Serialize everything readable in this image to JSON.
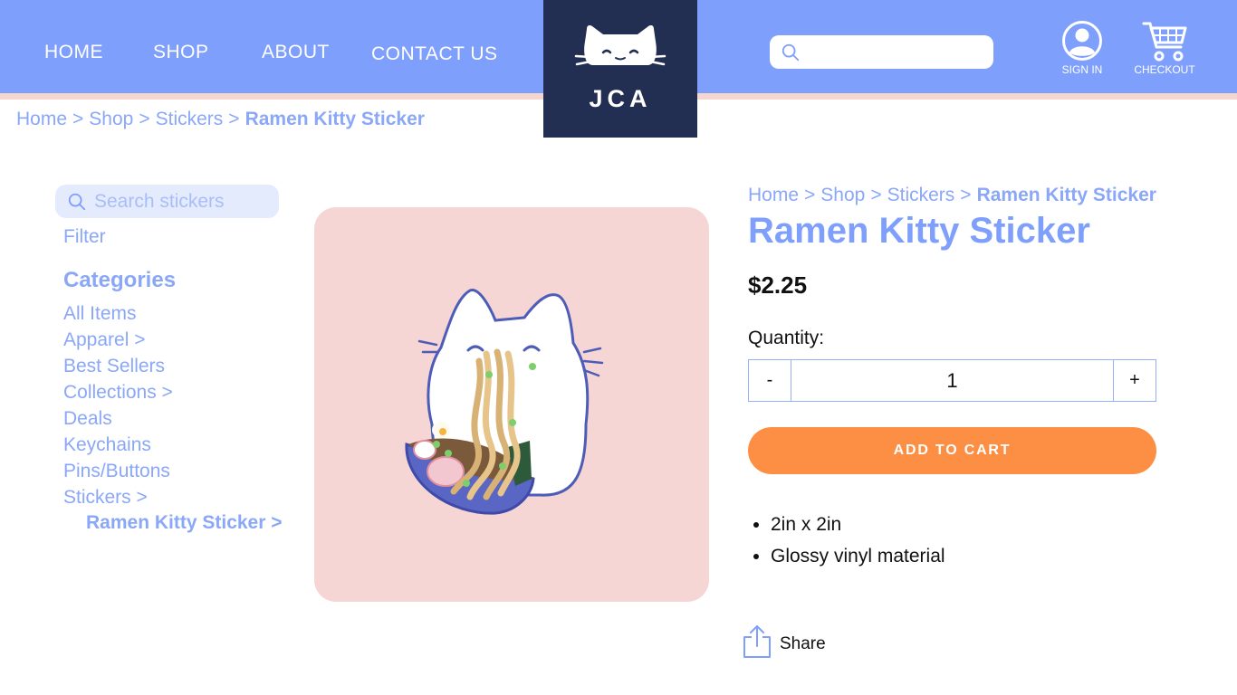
{
  "nav": {
    "items": [
      {
        "label": "HOME"
      },
      {
        "label": "SHOP"
      },
      {
        "label": "ABOUT"
      },
      {
        "label": "CONTACT US"
      }
    ]
  },
  "logo": {
    "text": "JCA"
  },
  "header": {
    "search_placeholder": "",
    "signin_label": "SIGN IN",
    "checkout_label": "CHECKOUT"
  },
  "breadcrumb": {
    "items": [
      "Home",
      "Shop",
      "Stickers",
      "Ramen Kitty Sticker"
    ],
    "separator": ">"
  },
  "sidebar": {
    "search_placeholder": "Search stickers",
    "filter_label": "Filter",
    "categories_title": "Categories",
    "categories": [
      "All Items",
      "Apparel >",
      "Best Sellers",
      "Collections >",
      "Deals",
      "Keychains",
      "Pins/Buttons",
      "Stickers >"
    ],
    "active_subcategory": "Ramen Kitty Sticker >"
  },
  "product": {
    "title": "Ramen Kitty Sticker",
    "price": "$2.25",
    "quantity_label": "Quantity:",
    "quantity_value": "1",
    "minus_label": "-",
    "plus_label": "+",
    "add_to_cart_label": "ADD TO CART",
    "features": [
      "2in x 2in",
      "Glossy vinyl material"
    ],
    "share_label": "Share"
  },
  "colors": {
    "header_bg": "#7f9ffc",
    "logo_bg": "#232f52",
    "accent_text": "#8aa7f8",
    "cta": "#fd8f45",
    "image_bg": "#f6d5d5"
  },
  "icons": {
    "search": "search-icon",
    "user": "user-icon",
    "cart": "cart-icon",
    "share": "share-icon"
  }
}
